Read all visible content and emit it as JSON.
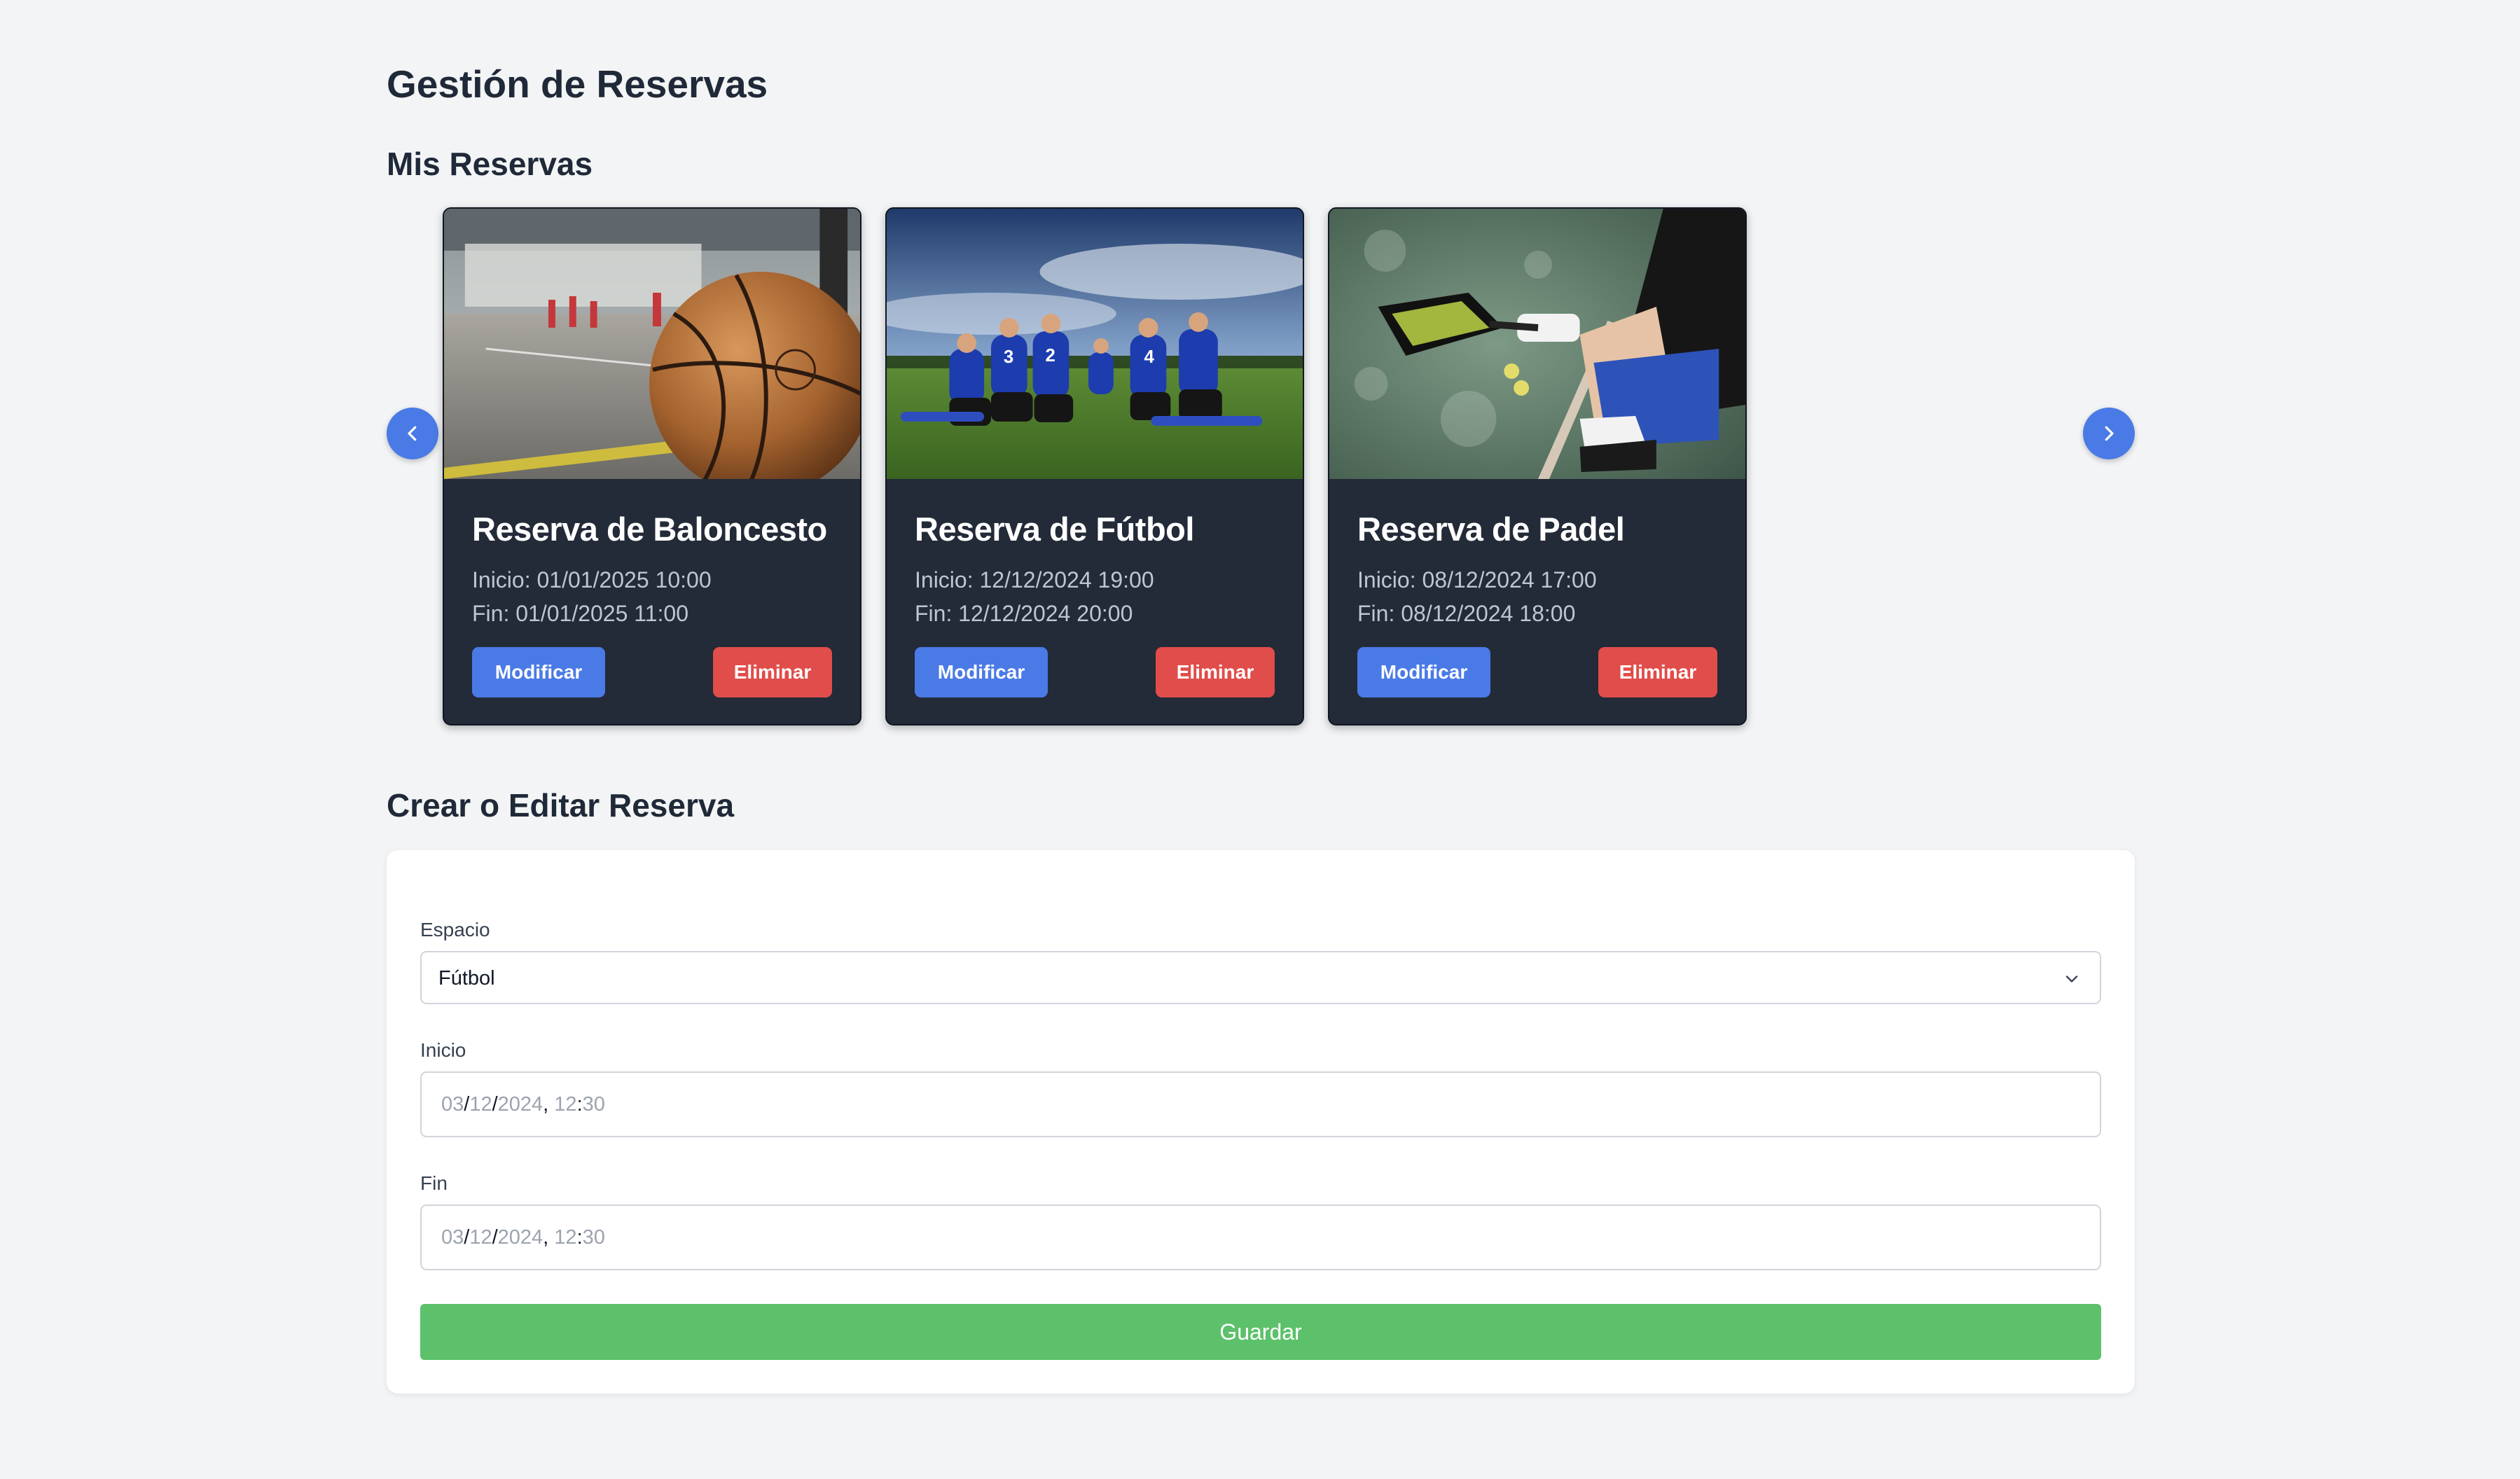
{
  "page": {
    "title": "Gestión de Reservas"
  },
  "reservations": {
    "heading": "Mis Reservas",
    "prev_icon": "chevron-left-icon",
    "next_icon": "chevron-right-icon",
    "cards": [
      {
        "image": "basketball-court-photo",
        "title": "Reserva de Baloncesto",
        "start": "Inicio: 01/01/2025 10:00",
        "end": "Fin: 01/01/2025 11:00",
        "modify_label": "Modificar",
        "delete_label": "Eliminar"
      },
      {
        "image": "football-team-photo",
        "title": "Reserva de Fútbol",
        "start": "Inicio: 12/12/2024 19:00",
        "end": "Fin: 12/12/2024 20:00",
        "modify_label": "Modificar",
        "delete_label": "Eliminar"
      },
      {
        "image": "padel-player-photo",
        "title": "Reserva de Padel",
        "start": "Inicio: 08/12/2024 17:00",
        "end": "Fin: 08/12/2024 18:00",
        "modify_label": "Modificar",
        "delete_label": "Eliminar"
      }
    ]
  },
  "form": {
    "heading": "Crear o Editar Reserva",
    "space_label": "Espacio",
    "space_value": "Fútbol",
    "start_label": "Inicio",
    "start_value": {
      "day": "03",
      "month": "12",
      "year": "2024",
      "hour": "12",
      "minute": "30"
    },
    "end_label": "Fin",
    "end_value": {
      "day": "03",
      "month": "12",
      "year": "2024",
      "hour": "12",
      "minute": "30"
    },
    "save_label": "Guardar"
  },
  "colors": {
    "background": "#f3f4f6",
    "card": "#232a38",
    "primary": "#4a7ae6",
    "danger": "#e04d4a",
    "success": "#5cc16a"
  }
}
